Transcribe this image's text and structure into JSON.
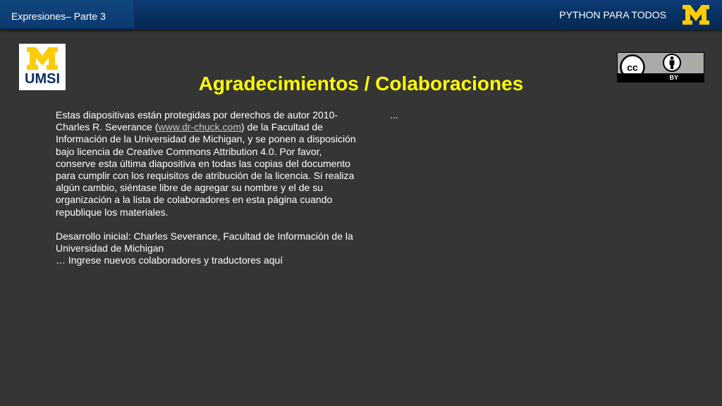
{
  "header": {
    "section_title": "Expresiones– Parte 3",
    "course_title": "PYTHON PARA TODOS",
    "logo_icon": "michigan-m-icon",
    "logo_color": "#ffcb05"
  },
  "umsi_logo": {
    "text": "UMSI",
    "icon": "michigan-m-icon",
    "m_color": "#ffcb05",
    "text_color": "#0b2e63"
  },
  "license_badge": {
    "cc_icon": "creative-commons-icon",
    "cc_text": "cc",
    "by_icon": "attribution-person-icon",
    "by_label": "BY"
  },
  "main": {
    "title": "Agradecimientos / Colaboraciones",
    "title_color": "#ffff00",
    "paragraph1_part1": "Estas diapositivas están protegidas por derechos de autor 2010- Charles R. Severance (",
    "paragraph1_link": "www.dr-chuck.com",
    "paragraph1_part2": ") de la Facultad de Información de la Universidad de Michigan, y se ponen a disposición bajo licencia de Creative Commons Attribution 4.0. Por favor, conserve esta última diapositiva en todas las copias del documento para cumplir con los requisitos de atribución de la licencia. Si realiza algún cambio, siéntase libre de agregar su nombre y el de su organización a la lista de colaboradores en esta página cuando republique los materiales.",
    "paragraph2_line1": "Desarrollo inicial: Charles Severance, Facultad de Información de la Universidad de Michigan",
    "paragraph2_line2": "… Ingrese nuevos colaboradores y traductores aquí",
    "right_column": "..."
  }
}
